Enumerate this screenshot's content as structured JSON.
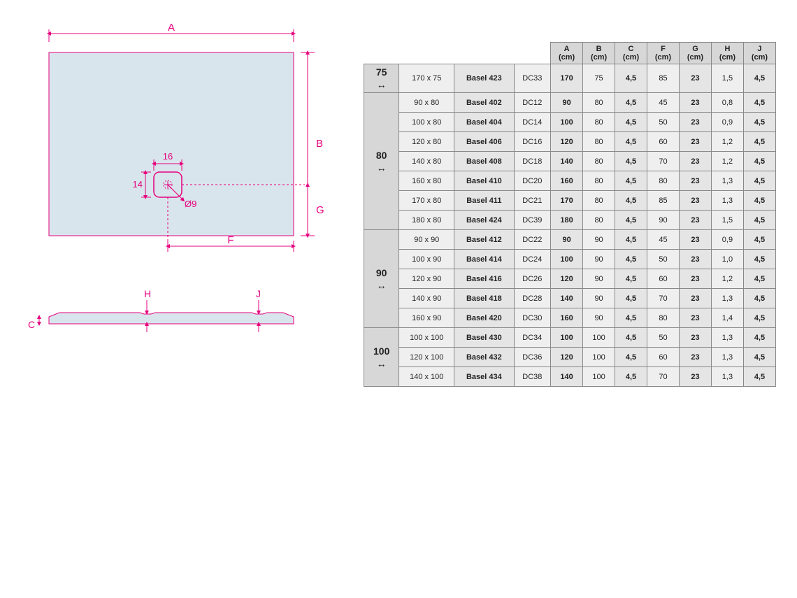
{
  "colors": {
    "pink": "#E6007E",
    "fill": "#D9E5EC",
    "stroke": "#E6007E",
    "gray": "#888"
  },
  "diagram": {
    "labels": {
      "A": "A",
      "B": "B",
      "C": "C",
      "F": "F",
      "G": "G",
      "H": "H",
      "J": "J"
    },
    "drain": {
      "w": "16",
      "h": "14",
      "dia": "Ø9"
    }
  },
  "columns": [
    "A (cm)",
    "B (cm)",
    "C (cm)",
    "F (cm)",
    "G (cm)",
    "H (cm)",
    "J (cm)"
  ],
  "groups": [
    {
      "label": "75",
      "rows": [
        {
          "size": "170 x 75",
          "model": "Basel 423",
          "code": "DC33",
          "vals": [
            "170",
            "75",
            "4,5",
            "85",
            "23",
            "1,5",
            "4,5"
          ]
        }
      ]
    },
    {
      "label": "80",
      "rows": [
        {
          "size": "90 x 80",
          "model": "Basel 402",
          "code": "DC12",
          "vals": [
            "90",
            "80",
            "4,5",
            "45",
            "23",
            "0,8",
            "4,5"
          ]
        },
        {
          "size": "100 x 80",
          "model": "Basel 404",
          "code": "DC14",
          "vals": [
            "100",
            "80",
            "4,5",
            "50",
            "23",
            "0,9",
            "4,5"
          ]
        },
        {
          "size": "120 x 80",
          "model": "Basel 406",
          "code": "DC16",
          "vals": [
            "120",
            "80",
            "4,5",
            "60",
            "23",
            "1,2",
            "4,5"
          ]
        },
        {
          "size": "140 x 80",
          "model": "Basel 408",
          "code": "DC18",
          "vals": [
            "140",
            "80",
            "4,5",
            "70",
            "23",
            "1,2",
            "4,5"
          ]
        },
        {
          "size": "160 x 80",
          "model": "Basel 410",
          "code": "DC20",
          "vals": [
            "160",
            "80",
            "4,5",
            "80",
            "23",
            "1,3",
            "4,5"
          ]
        },
        {
          "size": "170 x 80",
          "model": "Basel 411",
          "code": "DC21",
          "vals": [
            "170",
            "80",
            "4,5",
            "85",
            "23",
            "1,3",
            "4,5"
          ]
        },
        {
          "size": "180 x 80",
          "model": "Basel 424",
          "code": "DC39",
          "vals": [
            "180",
            "80",
            "4,5",
            "90",
            "23",
            "1,5",
            "4,5"
          ]
        }
      ]
    },
    {
      "label": "90",
      "rows": [
        {
          "size": "90 x 90",
          "model": "Basel 412",
          "code": "DC22",
          "vals": [
            "90",
            "90",
            "4,5",
            "45",
            "23",
            "0,9",
            "4,5"
          ]
        },
        {
          "size": "100 x 90",
          "model": "Basel 414",
          "code": "DC24",
          "vals": [
            "100",
            "90",
            "4,5",
            "50",
            "23",
            "1,0",
            "4,5"
          ]
        },
        {
          "size": "120 x 90",
          "model": "Basel 416",
          "code": "DC26",
          "vals": [
            "120",
            "90",
            "4,5",
            "60",
            "23",
            "1,2",
            "4,5"
          ]
        },
        {
          "size": "140 x 90",
          "model": "Basel 418",
          "code": "DC28",
          "vals": [
            "140",
            "90",
            "4,5",
            "70",
            "23",
            "1,3",
            "4,5"
          ]
        },
        {
          "size": "160 x 90",
          "model": "Basel 420",
          "code": "DC30",
          "vals": [
            "160",
            "90",
            "4,5",
            "80",
            "23",
            "1,4",
            "4,5"
          ]
        }
      ]
    },
    {
      "label": "100",
      "rows": [
        {
          "size": "100 x 100",
          "model": "Basel 430",
          "code": "DC34",
          "vals": [
            "100",
            "100",
            "4,5",
            "50",
            "23",
            "1,3",
            "4,5"
          ]
        },
        {
          "size": "120 x 100",
          "model": "Basel 432",
          "code": "DC36",
          "vals": [
            "120",
            "100",
            "4,5",
            "60",
            "23",
            "1,3",
            "4,5"
          ]
        },
        {
          "size": "140 x 100",
          "model": "Basel 434",
          "code": "DC38",
          "vals": [
            "140",
            "100",
            "4,5",
            "70",
            "23",
            "1,3",
            "4,5"
          ]
        }
      ]
    }
  ]
}
